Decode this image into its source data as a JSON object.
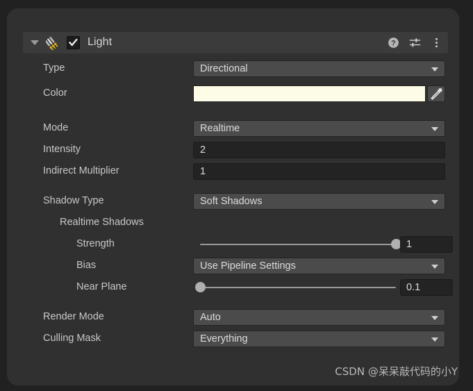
{
  "panel": {
    "component": {
      "title": "Light",
      "enabled": true,
      "foldout_expanded": true,
      "icon": "directional-light-icon",
      "header_icons": [
        {
          "name": "help-icon",
          "glyph": "?"
        },
        {
          "name": "preset-settings-icon",
          "glyph": "sliders"
        },
        {
          "name": "more-menu-icon",
          "glyph": "kebab"
        }
      ]
    },
    "rows": [
      {
        "name": "type",
        "label": "Type",
        "indent": 0,
        "control": "dropdown",
        "value": "Directional"
      },
      {
        "name": "color",
        "label": "Color",
        "indent": 0,
        "control": "color",
        "value": "#FDFCE6"
      },
      {
        "name": "mode",
        "label": "Mode",
        "indent": 0,
        "control": "dropdown",
        "value": "Realtime"
      },
      {
        "name": "intensity",
        "label": "Intensity",
        "indent": 0,
        "control": "number",
        "value": "2"
      },
      {
        "name": "indirect-multiplier",
        "label": "Indirect Multiplier",
        "indent": 0,
        "control": "number",
        "value": "1"
      },
      {
        "name": "shadow-type",
        "label": "Shadow Type",
        "indent": 0,
        "control": "dropdown",
        "value": "Soft Shadows"
      },
      {
        "name": "realtime-shadows",
        "label": "Realtime Shadows",
        "indent": 1,
        "control": "none",
        "value": ""
      },
      {
        "name": "strength",
        "label": "Strength",
        "indent": 2,
        "control": "slider",
        "value": "1",
        "fill": 1
      },
      {
        "name": "bias",
        "label": "Bias",
        "indent": 2,
        "control": "dropdown",
        "value": "Use Pipeline Settings"
      },
      {
        "name": "near-plane",
        "label": "Near Plane",
        "indent": 2,
        "control": "slider",
        "value": "0.1",
        "fill": 0
      },
      {
        "name": "render-mode",
        "label": "Render Mode",
        "indent": 0,
        "control": "dropdown",
        "value": "Auto"
      },
      {
        "name": "culling-mask",
        "label": "Culling Mask",
        "indent": 0,
        "control": "dropdown",
        "value": "Everything"
      }
    ]
  },
  "watermark": {
    "text": "CSDN @呆呆敲代码的小Y"
  },
  "colors": {
    "panel_bg": "#303030",
    "header_bg": "#3b3b3b",
    "dropdown_bg": "#4b4b4b",
    "numfield_bg": "#232323",
    "label_text": "#c8c8c8",
    "light_color_swatch": "#FDFCE6"
  }
}
